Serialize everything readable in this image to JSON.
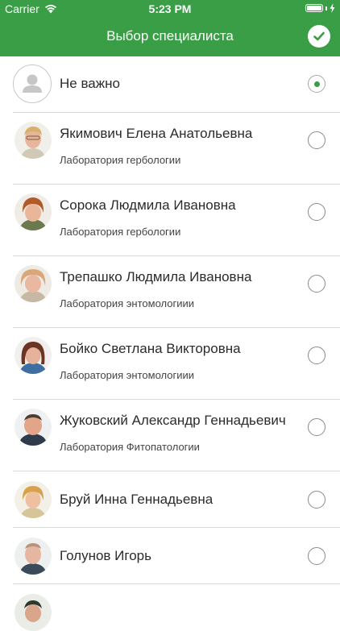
{
  "status_bar": {
    "carrier": "Carrier",
    "time": "5:23 PM",
    "battery_level": 1.0
  },
  "navbar": {
    "title": "Выбор специалиста",
    "confirm_icon": "checkmark-circle-icon"
  },
  "colors": {
    "accent": "#3a9e47",
    "divider": "#d9d9d9"
  },
  "options": [
    {
      "name": "Не важно",
      "subtitle": "",
      "selected": true,
      "avatar": "person-placeholder-icon"
    },
    {
      "name": "Якимович Елена Анатольевна",
      "subtitle": "Лаборатория гербологии",
      "selected": false,
      "avatar": "photo"
    },
    {
      "name": "Сорока Людмила Ивановна",
      "subtitle": "Лаборатория гербологии",
      "selected": false,
      "avatar": "photo"
    },
    {
      "name": "Трепашко Людмила Ивановна",
      "subtitle": "Лаборатория энтомологиии",
      "selected": false,
      "avatar": "photo"
    },
    {
      "name": "Бойко Светлана Викторовна",
      "subtitle": "Лаборатория энтомологиии",
      "selected": false,
      "avatar": "photo"
    },
    {
      "name": "Жуковский Александр Геннадьевич",
      "subtitle": "Лаборатория Фитопатологии",
      "selected": false,
      "avatar": "photo"
    },
    {
      "name": "Бруй Инна Геннадьевна",
      "subtitle": "",
      "selected": false,
      "avatar": "photo"
    },
    {
      "name": "Голунов Игорь",
      "subtitle": "",
      "selected": false,
      "avatar": "photo"
    }
  ]
}
